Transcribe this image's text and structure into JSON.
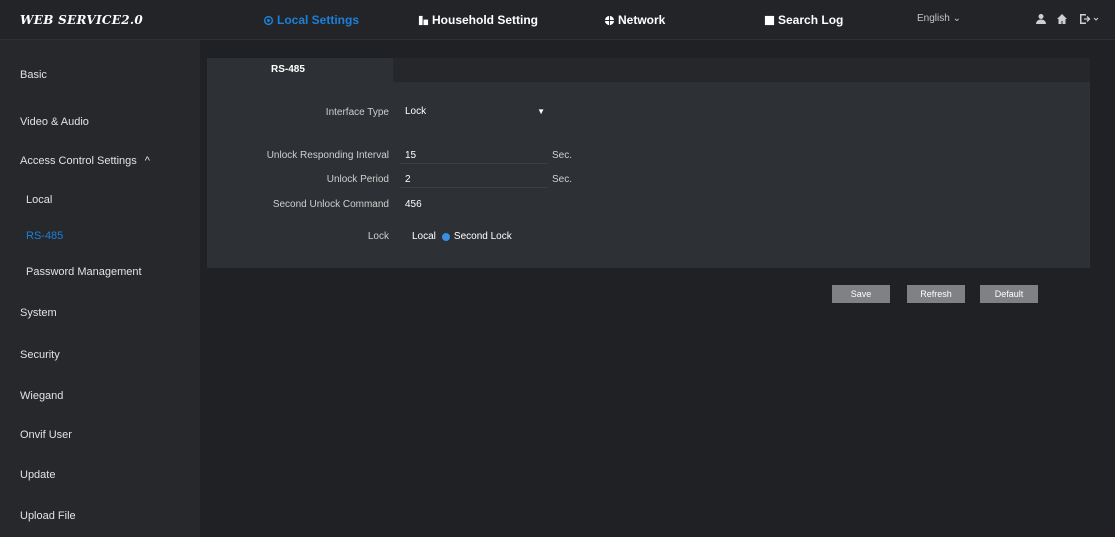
{
  "header": {
    "logo": "WEB SERVICE2.0",
    "nav": [
      {
        "label": "Local Settings",
        "icon": "gear-icon"
      },
      {
        "label": "Household Setting",
        "icon": "building-icon"
      },
      {
        "label": "Network",
        "icon": "globe-icon"
      },
      {
        "label": "Search Log",
        "icon": "log-icon"
      }
    ],
    "language": "English",
    "icons": [
      "user-icon",
      "home-icon",
      "logout-icon"
    ]
  },
  "sidebar": {
    "items": [
      {
        "label": "Basic"
      },
      {
        "label": "Video & Audio"
      },
      {
        "label": "Access Control Settings",
        "toggle": "^"
      },
      {
        "label": "Local"
      },
      {
        "label": "RS-485"
      },
      {
        "label": "Password Management"
      },
      {
        "label": "System"
      },
      {
        "label": "Security"
      },
      {
        "label": "Wiegand"
      },
      {
        "label": "Onvif User"
      },
      {
        "label": "Update"
      },
      {
        "label": "Upload File"
      }
    ],
    "active_item": "RS-485"
  },
  "main": {
    "tab": "RS-485",
    "fields": {
      "interface_type": {
        "label": "Interface Type",
        "value": "Lock"
      },
      "unlock_responding_interval": {
        "label": "Unlock Responding Interval",
        "value": "15",
        "unit": "Sec."
      },
      "unlock_period": {
        "label": "Unlock Period",
        "value": "2",
        "unit": "Sec."
      },
      "second_unlock_command": {
        "label": "Second Unlock Command",
        "value": "456"
      },
      "lock": {
        "label": "Lock",
        "options": [
          "Local",
          "Second Lock"
        ],
        "selected": "Second Lock"
      }
    },
    "buttons": {
      "save": "Save",
      "refresh": "Refresh",
      "default": "Default"
    }
  },
  "colors": {
    "accent": "#1c80d8",
    "background": "#1f2125",
    "sidebar": "#26282c",
    "panel": "#2d3034",
    "button": "#7f8185"
  }
}
